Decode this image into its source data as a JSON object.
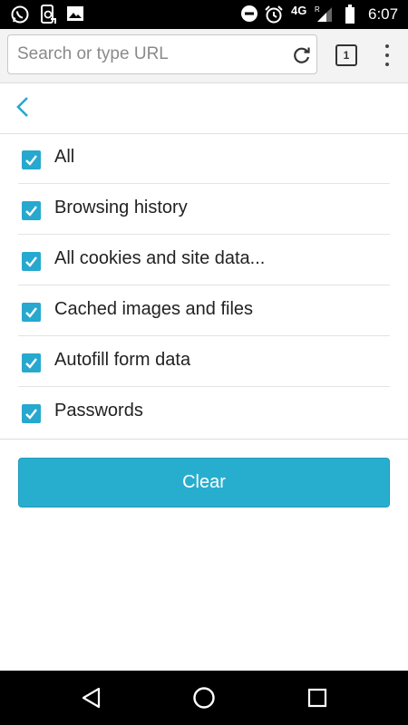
{
  "status_bar": {
    "left_icons": [
      "whatsapp-icon",
      "phone-sync-icon",
      "gallery-icon"
    ],
    "right_icons": [
      "do-not-disturb-icon",
      "alarm-icon",
      "signal-icon",
      "battery-icon"
    ],
    "network": "4G",
    "roaming": "R",
    "time": "6:07"
  },
  "toolbar": {
    "search_placeholder": "Search or type URL",
    "search_value": "",
    "tab_count": "1"
  },
  "options": [
    {
      "label": "All",
      "checked": true
    },
    {
      "label": "Browsing history",
      "checked": true
    },
    {
      "label": "All cookies and site data...",
      "checked": true
    },
    {
      "label": "Cached images and files",
      "checked": true
    },
    {
      "label": "Autofill form data",
      "checked": true
    },
    {
      "label": "Passwords",
      "checked": true
    }
  ],
  "clear_label": "Clear",
  "colors": {
    "accent": "#27aecf",
    "checkbox": "#27a8cf"
  }
}
